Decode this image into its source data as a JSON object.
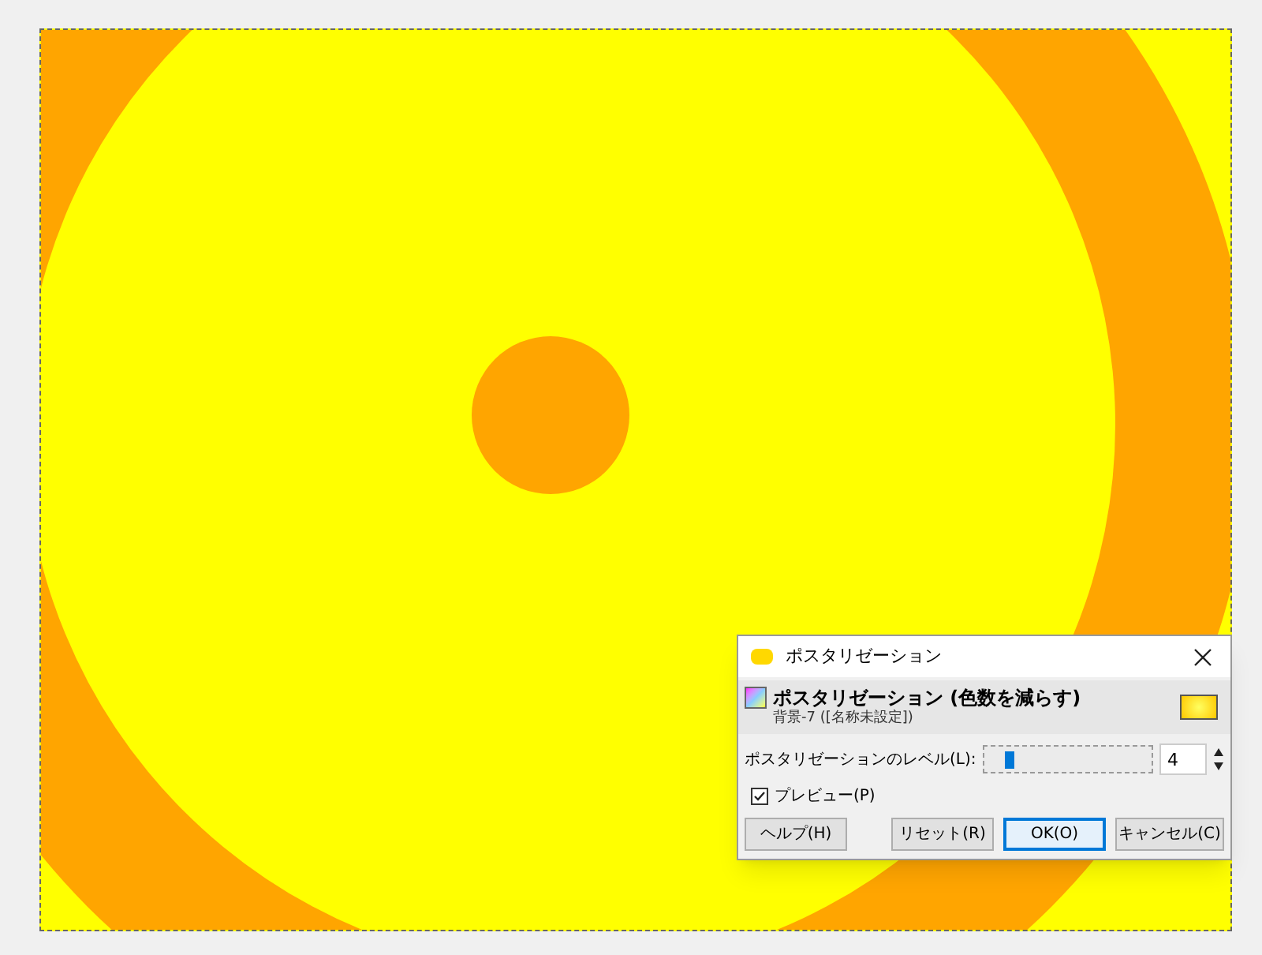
{
  "dialog": {
    "title": "ポスタリゼーション",
    "heading": "ポスタリゼーション (色数を減らす)",
    "subtitle": "背景-7 ([名称未設定])",
    "level": {
      "label": "ポスタリゼーションのレベル(L):",
      "level": 0.12,
      "value": "4"
    },
    "preview": {
      "label": "プレビュー(P)",
      "checked": true
    },
    "buttons": [
      {
        "label": "ヘルプ(H)",
        "selected": false
      },
      {
        "label": "リセット(R)",
        "selected": false
      },
      {
        "label": "OK(O)",
        "selected": true
      },
      {
        "label": "キャンセル(C)",
        "selected": false
      }
    ]
  }
}
